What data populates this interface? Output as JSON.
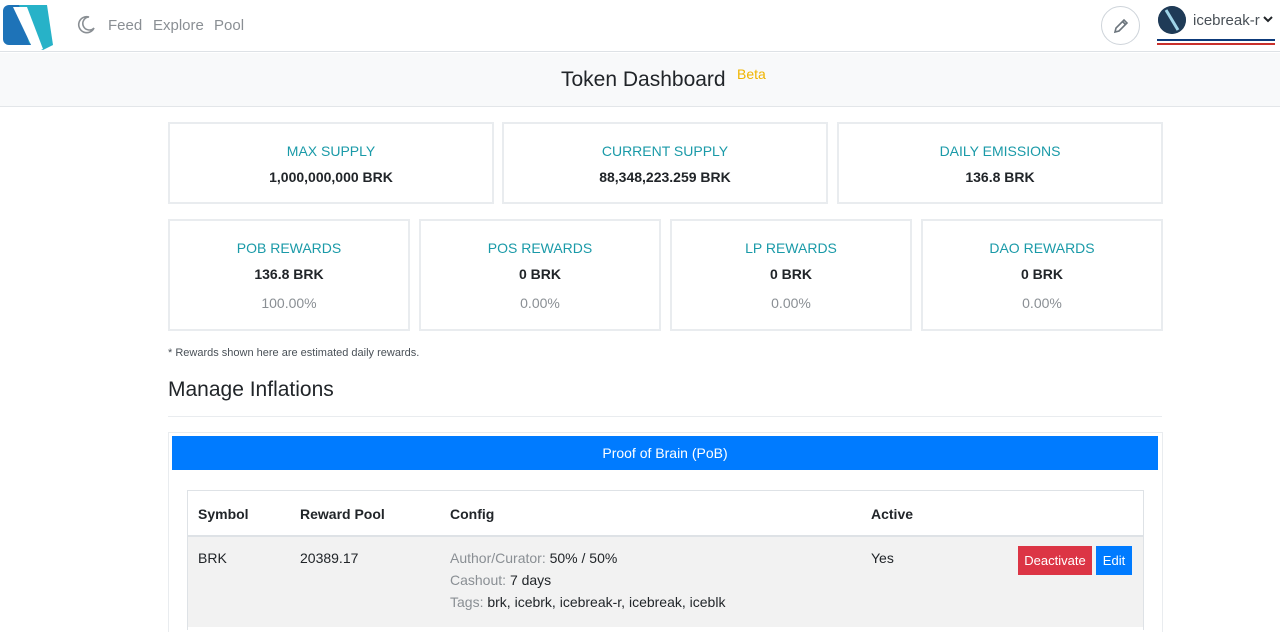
{
  "nav": {
    "links": [
      "Feed",
      "Explore",
      "Pool"
    ],
    "username": "icebreak-r"
  },
  "header": {
    "title": "Token Dashboard",
    "badge": "Beta"
  },
  "supply_cards": [
    {
      "label": "MAX SUPPLY",
      "value": "1,000,000,000 BRK"
    },
    {
      "label": "CURRENT SUPPLY",
      "value": "88,348,223.259 BRK"
    },
    {
      "label": "DAILY EMISSIONS",
      "value": "136.8 BRK"
    }
  ],
  "reward_cards": [
    {
      "label": "POB REWARDS",
      "value": "136.8 BRK",
      "percent": "100.00%"
    },
    {
      "label": "POS REWARDS",
      "value": "0 BRK",
      "percent": "0.00%"
    },
    {
      "label": "LP REWARDS",
      "value": "0 BRK",
      "percent": "0.00%"
    },
    {
      "label": "DAO REWARDS",
      "value": "0 BRK",
      "percent": "0.00%"
    }
  ],
  "note": "* Rewards shown here are estimated daily rewards.",
  "manage": {
    "title": "Manage Inflations",
    "pob_header": "Proof of Brain (PoB)",
    "columns": [
      "Symbol",
      "Reward Pool",
      "Config",
      "Active"
    ],
    "row": {
      "symbol": "BRK",
      "reward_pool": "20389.17",
      "config": {
        "author_label": "Author/Curator:",
        "author_value": "50% / 50%",
        "cashout_label": "Cashout:",
        "cashout_value": "7 days",
        "tags_label": "Tags:",
        "tags_value": "brk, icebrk, icebreak-r, icebreak, iceblk"
      },
      "active": "Yes",
      "deactivate_label": "Deactivate",
      "edit_label": "Edit"
    }
  },
  "colors": {
    "accent_teal": "#1a9aa8",
    "primary_blue": "#007bff",
    "danger_red": "#dc3545",
    "beta_yellow": "#f0b400"
  },
  "icons": [
    "app-logo",
    "moon-icon",
    "pencil-icon",
    "chevron-down-icon"
  ]
}
